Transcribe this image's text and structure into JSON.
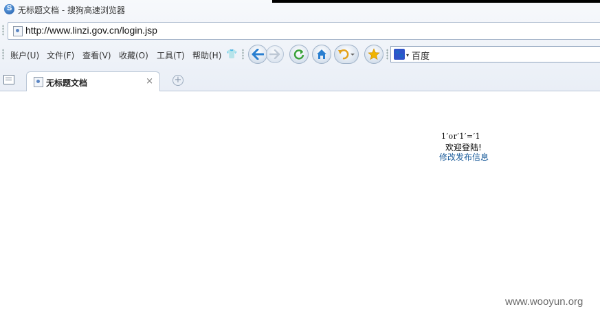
{
  "window": {
    "title": "无标题文档 - 搜狗高速浏览器"
  },
  "address_bar": {
    "url": "http://www.linzi.gov.cn/login.jsp"
  },
  "menu": [
    "账户(U)",
    "文件(F)",
    "查看(V)",
    "收藏(O)",
    "工具(T)",
    "帮助(H)"
  ],
  "toolbar_icons": {
    "skin": "shirt-icon",
    "back": "back-arrow-icon",
    "forward": "forward-arrow-icon",
    "refresh": "refresh-icon",
    "home": "home-icon",
    "undo": "undo-icon",
    "favorite": "star-icon"
  },
  "search": {
    "engine": "百度"
  },
  "tabs": [
    {
      "label": "无标题文档",
      "active": true
    }
  ],
  "page": {
    "injected_text": "1′or′1′=′1",
    "welcome": "欢迎登陆!",
    "link": "修改发布信息"
  },
  "watermark": "www.wooyun.org",
  "colors": {
    "link": "#1a5b9a",
    "back_arrow": "#2a7fd0",
    "refresh": "#3aa23a",
    "home": "#2a7fd0",
    "undo": "#e3a11b",
    "star": "#f0b400"
  }
}
